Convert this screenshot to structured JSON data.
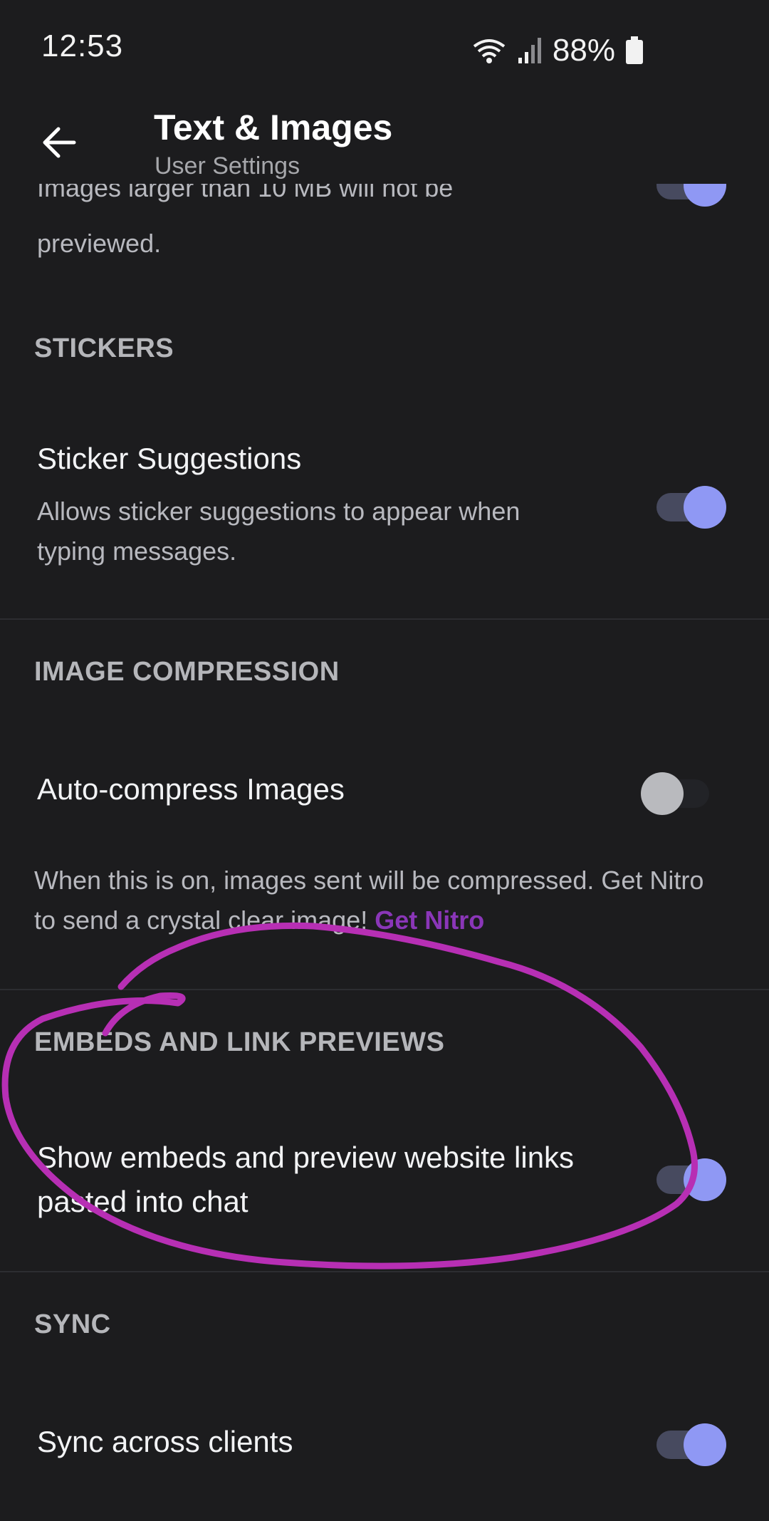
{
  "status_bar": {
    "time": "12:53",
    "battery": "88%"
  },
  "header": {
    "title": "Text & Images",
    "subtitle": "User Settings"
  },
  "partial_row": {
    "desc_cut": "Images larger than 10 MB will not be",
    "desc_end": "previewed."
  },
  "stickers": {
    "header": "STICKERS",
    "title": "Sticker Suggestions",
    "desc": "Allows sticker suggestions to appear when typing messages."
  },
  "image_compression": {
    "header": "IMAGE COMPRESSION",
    "title": "Auto-compress Images",
    "desc": "When this is on, images sent will be compressed. Get Nitro to send a crystal clear image! ",
    "link": "Get Nitro"
  },
  "embeds": {
    "header": "EMBEDS AND LINK PREVIEWS",
    "title": "Show embeds and preview website links pasted into chat"
  },
  "sync": {
    "header": "SYNC",
    "title": "Sync across clients"
  },
  "colors": {
    "accent": "#8f98f4",
    "annotation": "#b72fb4",
    "background": "#1c1c1e"
  }
}
